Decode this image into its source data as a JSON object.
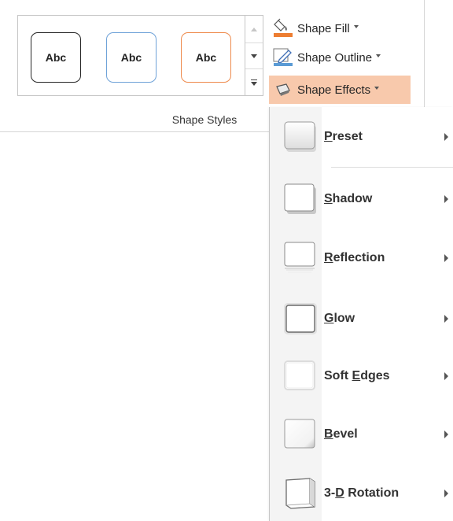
{
  "ribbon": {
    "group_label": "Shape Styles",
    "gallery": {
      "swatches": [
        "Abc",
        "Abc",
        "Abc"
      ]
    },
    "commands": {
      "shape_fill": "Shape Fill",
      "shape_outline": "Shape Outline",
      "shape_effects": "Shape Effects"
    }
  },
  "menu": {
    "items": [
      {
        "pre": "",
        "key": "P",
        "post": "reset"
      },
      {
        "pre": "",
        "key": "S",
        "post": "hadow"
      },
      {
        "pre": "",
        "key": "R",
        "post": "eflection"
      },
      {
        "pre": "",
        "key": "G",
        "post": "low"
      },
      {
        "pre": "Soft ",
        "key": "E",
        "post": "dges"
      },
      {
        "pre": "",
        "key": "B",
        "post": "evel"
      },
      {
        "pre": "3-",
        "key": "D",
        "post": " Rotation"
      }
    ]
  },
  "colors": {
    "highlight": "#f8c9ac",
    "fill_bar": "#ed7d31",
    "outline_bar": "#5b9bd5"
  }
}
